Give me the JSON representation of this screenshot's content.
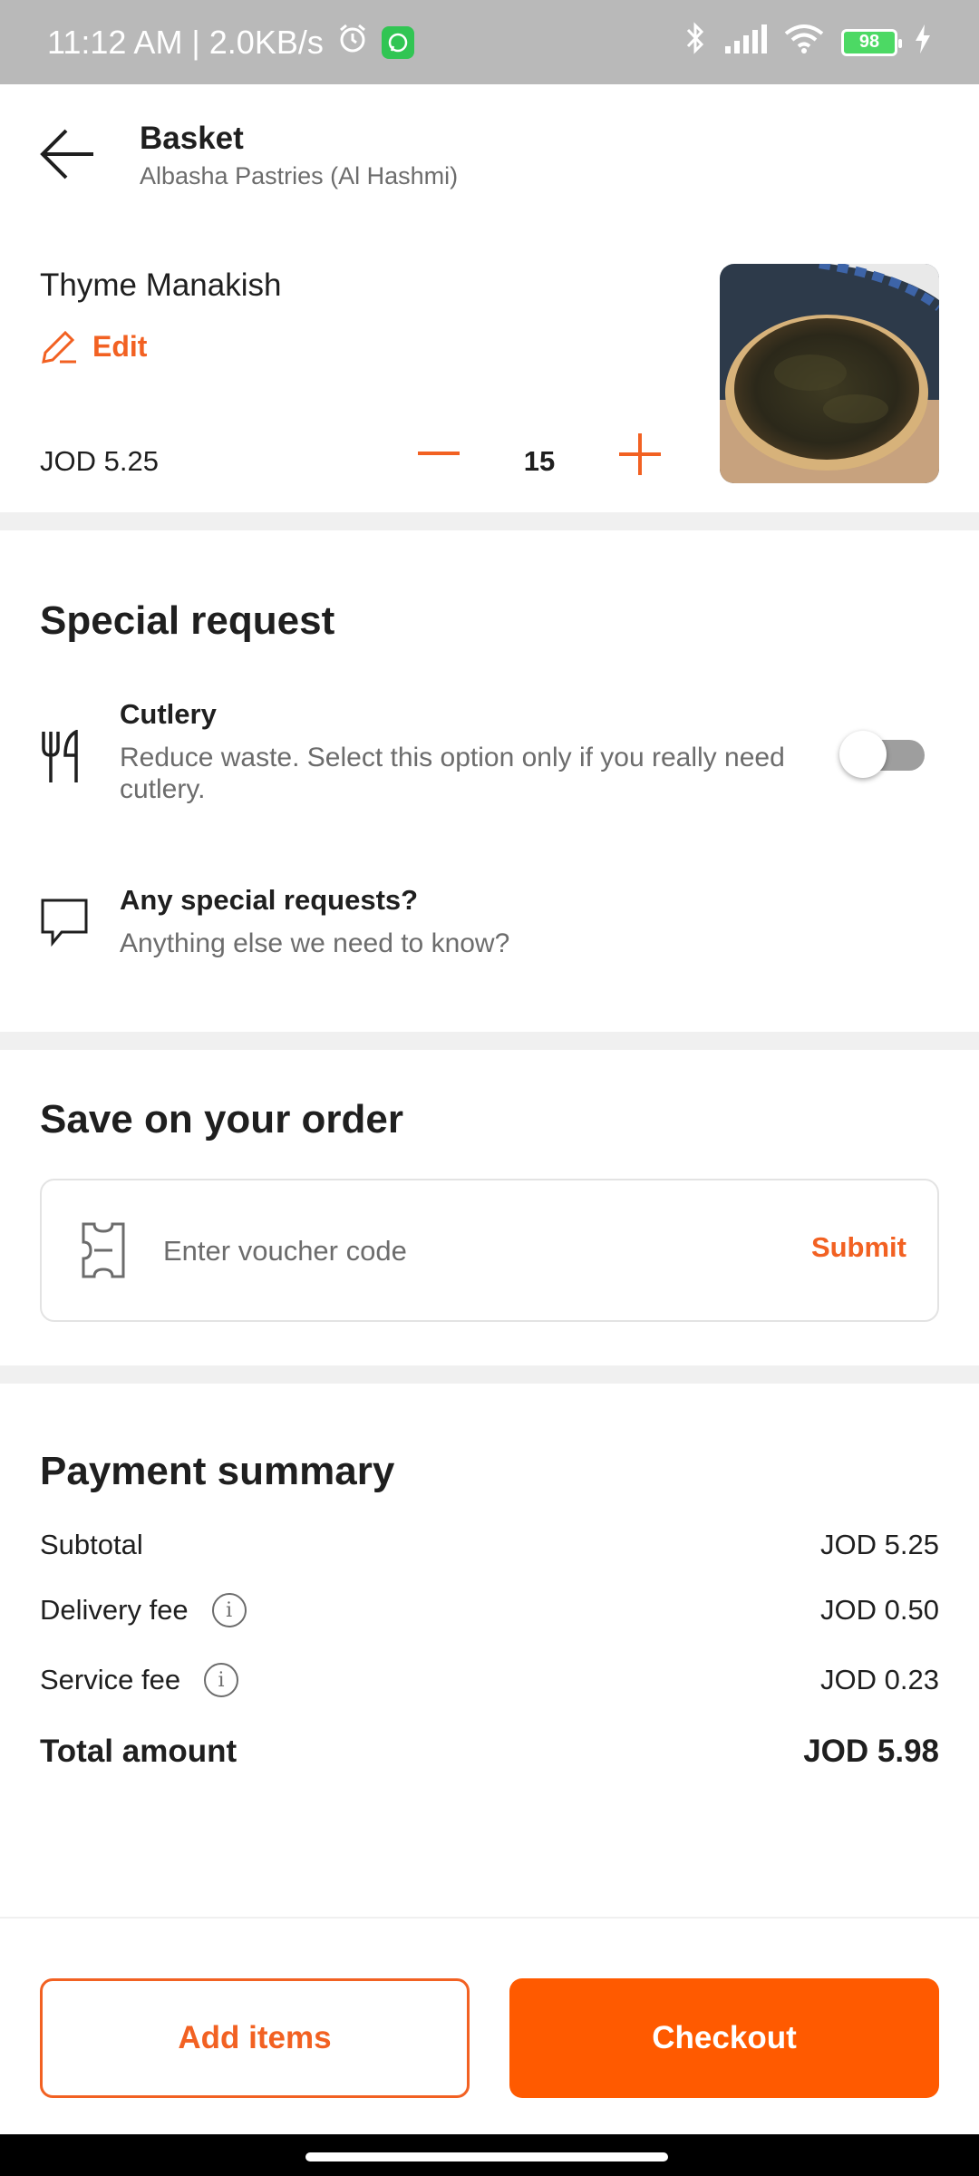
{
  "status_bar": {
    "time_speed": "11:12 AM | 2.0KB/s",
    "battery": "98"
  },
  "header": {
    "title": "Basket",
    "subtitle": "Albasha Pastries (Al Hashmi)"
  },
  "item": {
    "name": "Thyme Manakish",
    "edit_label": "Edit",
    "price": "JOD 5.25",
    "quantity": "15"
  },
  "special_request": {
    "title": "Special request",
    "cutlery_label": "Cutlery",
    "cutlery_desc": "Reduce waste. Select this option only if you really need cutlery.",
    "cutlery_enabled": false,
    "requests_label": "Any special requests?",
    "requests_desc": "Anything else we need to know?"
  },
  "voucher": {
    "title": "Save on your order",
    "placeholder": "Enter voucher code",
    "submit_label": "Submit"
  },
  "payment": {
    "title": "Payment summary",
    "rows": [
      {
        "label": "Subtotal",
        "value": "JOD 5.25"
      },
      {
        "label": "Delivery fee",
        "value": "JOD 0.50"
      },
      {
        "label": "Service fee",
        "value": "JOD 0.23"
      }
    ],
    "total_label": "Total amount",
    "total_value": "JOD 5.98"
  },
  "actions": {
    "add_items_label": "Add items",
    "checkout_label": "Checkout"
  },
  "colors": {
    "accent": "#f26122",
    "primary_button": "#ff5a00"
  }
}
